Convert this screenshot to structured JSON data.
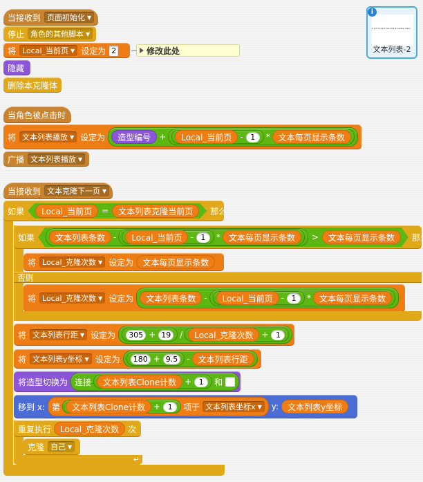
{
  "script1": {
    "when_receive": "当接收到",
    "message": "页面初始化",
    "stop": "停止",
    "stop_option": "角色的其他脚本",
    "set": "将",
    "set_var": "Local_当前页",
    "set_to": "设定为",
    "set_value": "2",
    "comment": "修改此处",
    "hide": "隐藏",
    "delete_clone": "删除本克隆体"
  },
  "script2": {
    "when_clicked": "当角色被点击时",
    "set": "将",
    "set_var": "文本列表播放",
    "set_to": "设定为",
    "costume_number": "造型编号",
    "plus": "+",
    "local_page": "Local_当前页",
    "minus": "-",
    "one": "1",
    "times": "*",
    "per_page": "文本每页显示条数",
    "broadcast": "广播",
    "broadcast_msg": "文本列表播放"
  },
  "script3": {
    "when_receive": "当接收到",
    "message": "文本克隆下一页",
    "if": "如果",
    "local_page": "Local_当前页",
    "equals": "=",
    "clone_page": "文本列表克隆当前页",
    "then": "那么",
    "if2": "如果",
    "list_count": "文本列表条数",
    "minus": "-",
    "one": "1",
    "times": "*",
    "per_page": "文本每页显示条数",
    "gt": ">",
    "then2": "那么",
    "set": "将",
    "clone_count_var": "Local_克隆次数",
    "set_to": "设定为",
    "else": "否则",
    "row_gap_var": "文本列表行距",
    "n305": "305",
    "plus": "+",
    "n19": "19",
    "divide": "/",
    "local_clone_count": "Local_克隆次数",
    "ycoord_var": "文本列表y坐标",
    "n180": "180",
    "n95": "9.5",
    "row_gap": "文本列表行距",
    "switch_costume": "将造型切换为",
    "join": "连接",
    "clone_index": "文本列表Clone计数",
    "and": "和",
    "goto": "移到 x:",
    "item": "第",
    "item_of": "项于",
    "xcoord_list": "文本列表坐标x",
    "y": "y:",
    "ycoord": "文本列表y坐标",
    "repeat": "重复执行",
    "times_suffix": "次",
    "clone": "克隆",
    "clone_target": "自己"
  },
  "sprite": {
    "name": "文本列表-2",
    "info": "i",
    "thumb_text": "0 1/3 Scratch text list  #number label"
  },
  "colors": {
    "events": "#c88330",
    "control": "#e1a91a",
    "data": "#ee7d16",
    "looks": "#8a55d7",
    "motion": "#4a6cd4",
    "operators": "#5cb712"
  }
}
